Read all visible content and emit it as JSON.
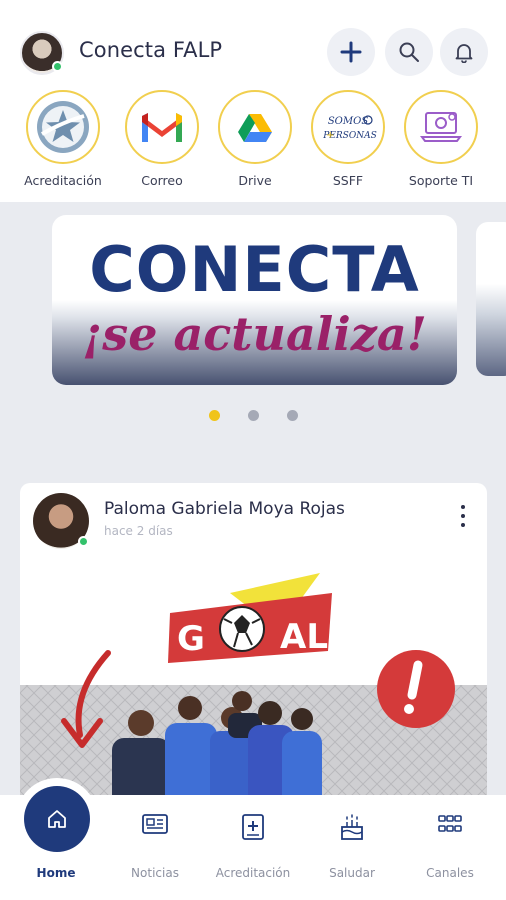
{
  "header": {
    "title": "Conecta FALP",
    "actions": [
      "add",
      "search",
      "notifications"
    ]
  },
  "shortcuts": [
    {
      "label": "Acreditación",
      "icon": "star-seal-icon"
    },
    {
      "label": "Correo",
      "icon": "gmail-icon"
    },
    {
      "label": "Drive",
      "icon": "drive-icon"
    },
    {
      "label": "SSFF",
      "icon": "somos-personas-logo",
      "logo_text": "SOMOS + PERSONAS"
    },
    {
      "label": "Soporte TI",
      "icon": "laptop-gear-icon"
    }
  ],
  "carousel": {
    "slides_total": 3,
    "active_index": 0,
    "banner": {
      "line1": "CONECTA",
      "line2": "¡se actualiza!"
    }
  },
  "post": {
    "author": "Paloma Gabriela Moya Rojas",
    "time": "hace 2 días",
    "image_text": "GOAL"
  },
  "tabbar": {
    "items": [
      {
        "label": "Home",
        "icon": "home-icon",
        "active": true
      },
      {
        "label": "Noticias",
        "icon": "news-icon",
        "active": false
      },
      {
        "label": "Acreditación",
        "icon": "add-document-icon",
        "active": false
      },
      {
        "label": "Saludar",
        "icon": "cake-icon",
        "active": false
      },
      {
        "label": "Canales",
        "icon": "grid-icon",
        "active": false
      }
    ]
  },
  "colors": {
    "primary": "#1f3a7c",
    "accent": "#f0c419",
    "ring": "#f1cf4f",
    "online": "#33c16b",
    "magenta": "#9a2168",
    "goal_red": "#d43a3a"
  }
}
